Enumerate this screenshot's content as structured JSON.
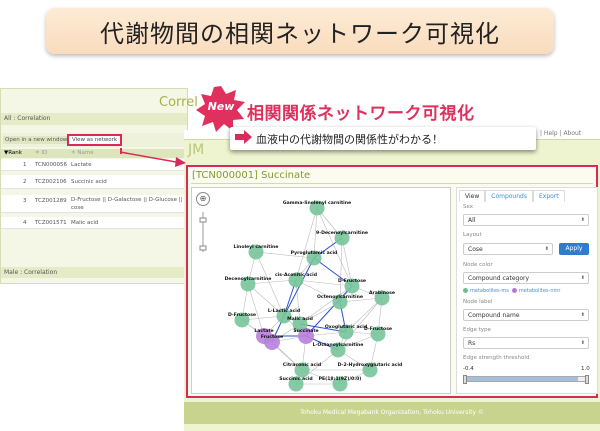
{
  "banner": {
    "title": "代謝物間の相関ネットワーク可視化"
  },
  "left_page": {
    "heading": "Correl",
    "header_bar": "All : Correlation",
    "open_button": "Open in a new window",
    "network_button": "View as network",
    "columns": [
      "▼Rank",
      "≑ ID",
      "≑ Name"
    ],
    "rows": [
      {
        "rank": "1",
        "id": "TCN000056",
        "name": "Lactate"
      },
      {
        "rank": "2",
        "id": "TCZ002106",
        "name": "Succinic acid"
      },
      {
        "rank": "3",
        "id": "TCZ001289",
        "name": "D-Fructose || D-Galactose || D-Glucose || D-I",
        "name2": "cose"
      },
      {
        "rank": "4",
        "id": "TCZ001571",
        "name": "Malic acid"
      }
    ],
    "male_bar": "Male : Correlation"
  },
  "site": {
    "help_links": "| Help | About",
    "logo_text": "JM",
    "footer": "Tohoku Medical Megabank Organization, Tohoku University ©"
  },
  "callout": {
    "badge": "New",
    "title": "相関関係ネットワーク可視化",
    "subtitle": "血液中の代謝物間の関係性がわかる！"
  },
  "panel": {
    "title": "[TCN000001] Succinate",
    "zoom_label": "⊕",
    "tabs": [
      "View",
      "Compounds",
      "Export"
    ],
    "sex_label": "Sex",
    "sex_value": "All",
    "layout_label": "Layout",
    "layout_value": "Cose",
    "apply": "Apply",
    "node_color_label": "Node color",
    "node_color_value": "Compound category",
    "legend_ms": "metabolites-ms",
    "legend_nmr": "metabolites-nmr",
    "node_label_label": "Node label",
    "node_label_value": "Compound name",
    "edge_type_label": "Edge type",
    "edge_type_value": "Rs",
    "edge_threshold_label": "Edge strength threshold",
    "threshold_min": "-0.4",
    "threshold_max": "1.0",
    "threshold_fraction": 0.92,
    "chevron": "⬍"
  },
  "graph": {
    "nodes": [
      {
        "label": "Gamma-linolenyl carnitine",
        "type": "ms"
      },
      {
        "label": "9-Decenoylcarnitine",
        "type": "ms"
      },
      {
        "label": "Linoleyl carnitine",
        "type": "ms"
      },
      {
        "label": "Pyroglutamic acid",
        "type": "ms"
      },
      {
        "label": "Decenoylcarnitine",
        "type": "ms"
      },
      {
        "label": "cis-Aconitic acid",
        "type": "ms"
      },
      {
        "label": "D-Fructose",
        "type": "ms"
      },
      {
        "label": "Octenoylcarnitine",
        "type": "ms"
      },
      {
        "label": "L-Lactic acid",
        "type": "ms"
      },
      {
        "label": "Arabinose",
        "type": "ms"
      },
      {
        "label": "D-Fructose",
        "type": "ms"
      },
      {
        "label": "Malic acid",
        "type": "ms"
      },
      {
        "label": "Lactate",
        "type": "nmr"
      },
      {
        "label": "Fructose",
        "type": "nmr"
      },
      {
        "label": "Succinate",
        "type": "nmr"
      },
      {
        "label": "Oxoglutaric acid",
        "type": "ms"
      },
      {
        "label": "L-Octanoylcarnitine",
        "type": "ms"
      },
      {
        "label": "D-Fructose",
        "type": "ms"
      },
      {
        "label": "Citraconic acid",
        "type": "ms"
      },
      {
        "label": "D-2-Hydroxyglutaric acid",
        "type": "ms"
      },
      {
        "label": "Succinic acid",
        "type": "ms"
      },
      {
        "label": "PE(18:1(9Z)/0:0)",
        "type": "ms"
      }
    ]
  }
}
